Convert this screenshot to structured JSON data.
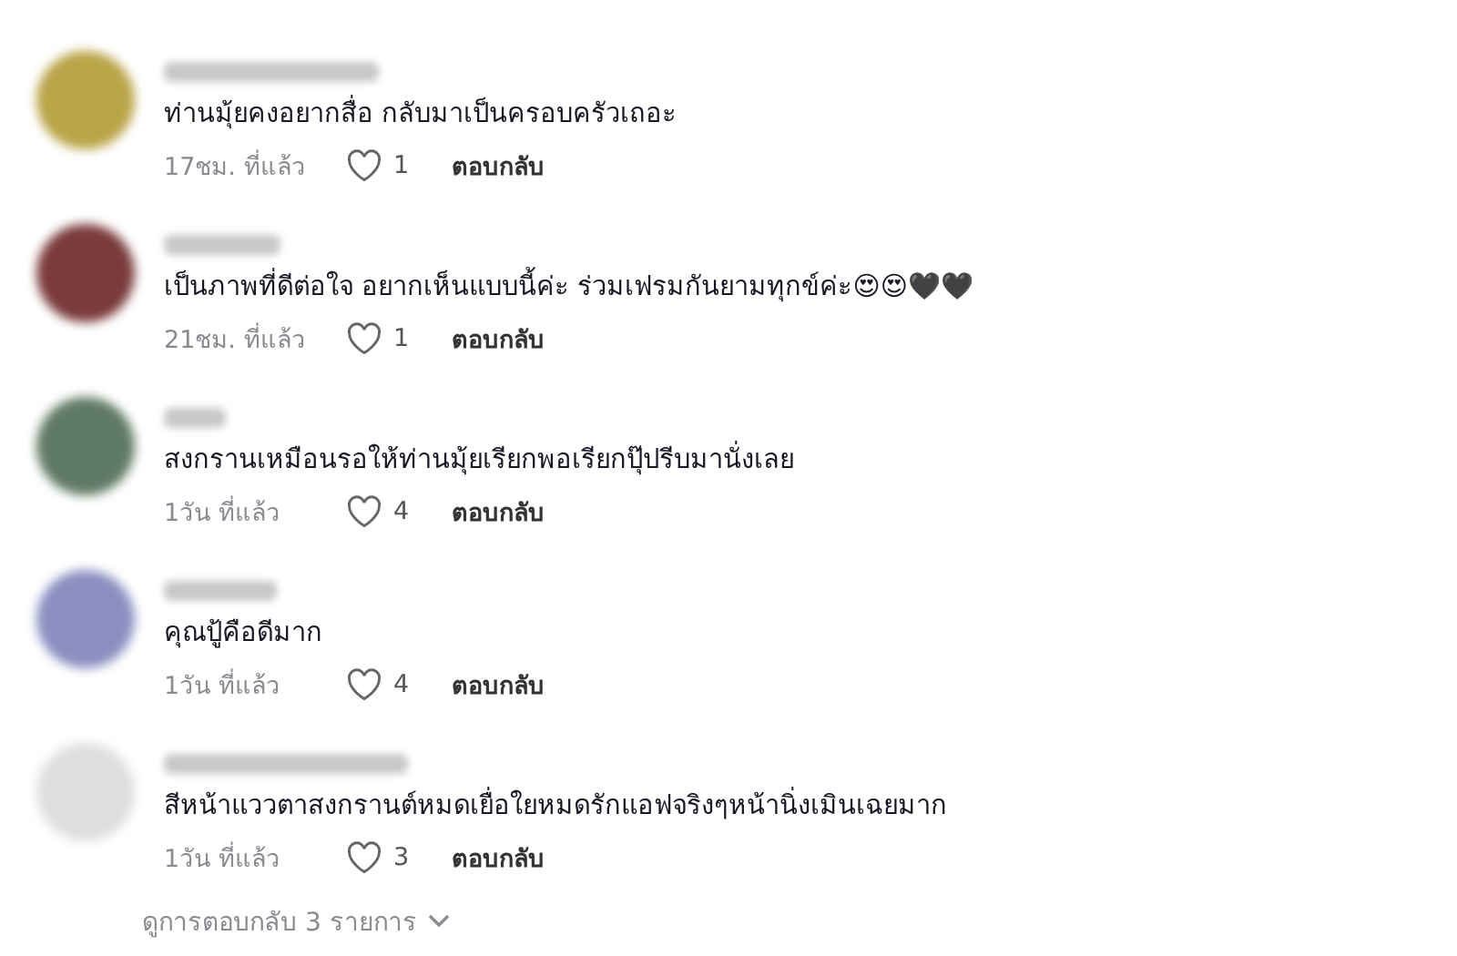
{
  "comments": [
    {
      "text": "ท่านมุ้ยคงอยากสื่อ กลับมาเป็นครอบครัวเถอะ",
      "time": "17ชม. ที่แล้ว",
      "likes": "1",
      "reply": "ตอบกลับ",
      "liked": false
    },
    {
      "text": "เป็นภาพที่ดีต่อใจ อยากเห็นแบบนี้ค่ะ ร่วมเฟรมกันยามทุกข์ค่ะ😍😍🖤🖤",
      "time": "21ชม. ที่แล้ว",
      "likes": "1",
      "reply": "ตอบกลับ",
      "liked": false
    },
    {
      "text": "สงกรานเหมือนรอให้ท่านมุ้ยเรียกพอเรียกปุ๊ปรีบมานั่งเลย",
      "time": "1วัน ที่แล้ว",
      "likes": "4",
      "reply": "ตอบกลับ",
      "liked": false
    },
    {
      "text": "คุณปู้คือดีมาก",
      "time": "1วัน ที่แล้ว",
      "likes": "4",
      "reply": "ตอบกลับ",
      "liked": false
    },
    {
      "text": "สีหน้าแววตาสงกรานต์หมดเยื่อใยหมดรักแอฟจริงๆหน้านิ่งเมินเฉยมาก",
      "time": "1วัน ที่แล้ว",
      "likes": "3",
      "reply": "ตอบกลับ",
      "liked": false
    }
  ],
  "view_replies": "ดูการตอบกลับ 3 รายการ"
}
